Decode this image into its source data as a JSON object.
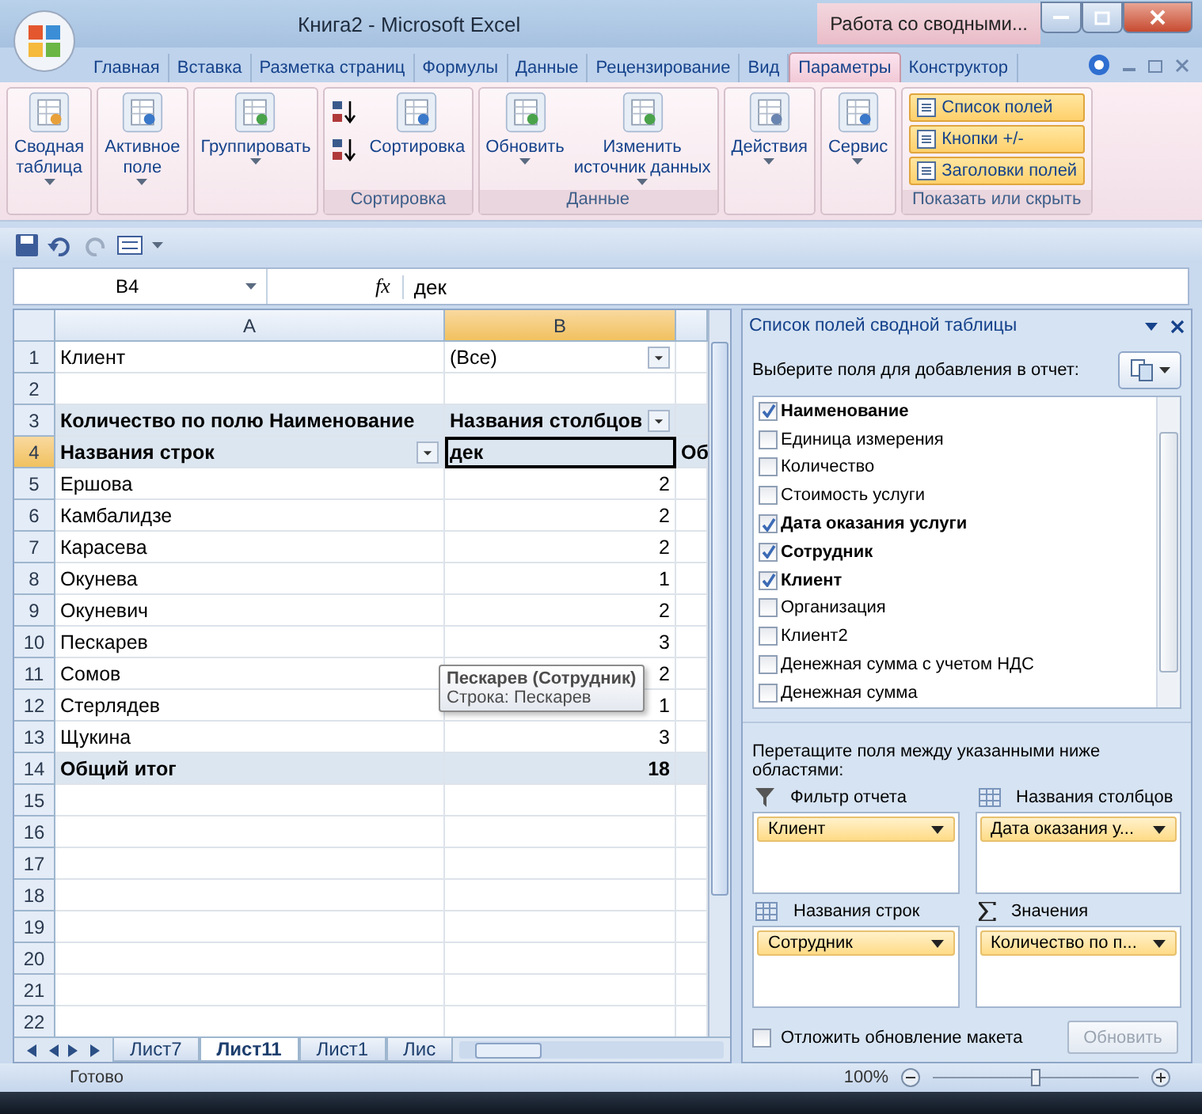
{
  "window": {
    "title": "Книга2 - Microsoft Excel",
    "context_title": "Работа со сводными..."
  },
  "ribbon_tabs": [
    {
      "label": "Главная",
      "selected": false
    },
    {
      "label": "Вставка",
      "selected": false
    },
    {
      "label": "Разметка страниц",
      "selected": false
    },
    {
      "label": "Формулы",
      "selected": false
    },
    {
      "label": "Данные",
      "selected": false
    },
    {
      "label": "Рецензирование",
      "selected": false
    },
    {
      "label": "Вид",
      "selected": false
    },
    {
      "label": "Параметры",
      "selected": true
    },
    {
      "label": "Конструктор",
      "selected": false
    }
  ],
  "ribbon_groups": [
    {
      "items": [
        {
          "kind": "large",
          "lines": [
            "Сводная",
            "таблица"
          ],
          "dropdown": true
        }
      ]
    },
    {
      "items": [
        {
          "kind": "large",
          "lines": [
            "Активное",
            "поле"
          ],
          "dropdown": true
        }
      ]
    },
    {
      "items": [
        {
          "kind": "large",
          "lines": [
            "Группировать"
          ],
          "dropdown": true
        }
      ]
    },
    {
      "label": "Сортировка",
      "items": [
        {
          "kind": "sort-stack"
        },
        {
          "kind": "large",
          "lines": [
            "Сортировка"
          ],
          "dropdown": false
        }
      ]
    },
    {
      "label": "Данные",
      "items": [
        {
          "kind": "large",
          "lines": [
            "Обновить"
          ],
          "dropdown": true
        },
        {
          "kind": "large",
          "lines": [
            "Изменить",
            "источник данных"
          ],
          "dropdown": true
        }
      ]
    },
    {
      "items": [
        {
          "kind": "large",
          "lines": [
            "Действия"
          ],
          "dropdown": true
        }
      ]
    },
    {
      "items": [
        {
          "kind": "large",
          "lines": [
            "Сервис"
          ],
          "dropdown": true
        }
      ]
    },
    {
      "label": "Показать или скрыть",
      "items": [
        {
          "kind": "toggle-stack",
          "toggles": [
            {
              "label": "Список полей",
              "on": true
            },
            {
              "label": "Кнопки +/-",
              "on": true
            },
            {
              "label": "Заголовки полей",
              "on": true
            }
          ]
        }
      ]
    }
  ],
  "formula_bar": {
    "cell": "B4",
    "fx": "fx",
    "value": "дек"
  },
  "columns": [
    {
      "label": "A",
      "selected": false
    },
    {
      "label": "B",
      "selected": true
    }
  ],
  "rows": [
    {
      "num": "1",
      "kind": "filter",
      "selected": false,
      "cells": [
        {
          "text": "Клиент"
        },
        {
          "text": "(Все)",
          "dropdown": true
        }
      ]
    },
    {
      "num": "2",
      "kind": "empty",
      "selected": false,
      "cells": []
    },
    {
      "num": "3",
      "kind": "header",
      "selected": false,
      "cells": [
        {
          "text": "Количество по полю Наименование"
        },
        {
          "text": "Названия столбцов",
          "dropdown": true
        }
      ]
    },
    {
      "num": "4",
      "kind": "header",
      "selected": true,
      "cells": [
        {
          "text": "Названия строк",
          "dropdown": true
        },
        {
          "text": "дек",
          "active": true
        },
        {
          "text": "Об"
        }
      ]
    },
    {
      "num": "5",
      "kind": "data",
      "selected": false,
      "cells": [
        {
          "text": "Ершова"
        },
        {
          "text": "2"
        }
      ]
    },
    {
      "num": "6",
      "kind": "data",
      "selected": false,
      "cells": [
        {
          "text": "Камбалидзе"
        },
        {
          "text": "2"
        }
      ]
    },
    {
      "num": "7",
      "kind": "data",
      "selected": false,
      "cells": [
        {
          "text": "Карасева"
        },
        {
          "text": "2"
        }
      ]
    },
    {
      "num": "8",
      "kind": "data",
      "selected": false,
      "cells": [
        {
          "text": "Окунева"
        },
        {
          "text": "1"
        }
      ]
    },
    {
      "num": "9",
      "kind": "data",
      "selected": false,
      "cells": [
        {
          "text": "Окуневич"
        },
        {
          "text": "2"
        }
      ]
    },
    {
      "num": "10",
      "kind": "data",
      "selected": false,
      "cells": [
        {
          "text": "Пескарев"
        },
        {
          "text": "3"
        }
      ]
    },
    {
      "num": "11",
      "kind": "data",
      "selected": false,
      "cells": [
        {
          "text": "Сомов"
        },
        {
          "text": "2"
        }
      ]
    },
    {
      "num": "12",
      "kind": "data",
      "selected": false,
      "cells": [
        {
          "text": "Стерлядев"
        },
        {
          "text": "1"
        }
      ]
    },
    {
      "num": "13",
      "kind": "data",
      "selected": false,
      "cells": [
        {
          "text": "Щукина"
        },
        {
          "text": "3"
        }
      ]
    },
    {
      "num": "14",
      "kind": "total",
      "selected": false,
      "cells": [
        {
          "text": "Общий итог"
        },
        {
          "text": "18"
        }
      ]
    },
    {
      "num": "15",
      "kind": "empty",
      "selected": false,
      "cells": []
    },
    {
      "num": "16",
      "kind": "empty",
      "selected": false,
      "cells": []
    },
    {
      "num": "17",
      "kind": "empty",
      "selected": false,
      "cells": []
    },
    {
      "num": "18",
      "kind": "empty",
      "selected": false,
      "cells": []
    },
    {
      "num": "19",
      "kind": "empty",
      "selected": false,
      "cells": []
    },
    {
      "num": "20",
      "kind": "empty",
      "selected": false,
      "cells": []
    },
    {
      "num": "21",
      "kind": "empty",
      "selected": false,
      "cells": []
    },
    {
      "num": "22",
      "kind": "empty",
      "selected": false,
      "cells": []
    }
  ],
  "tooltip": {
    "title": "Пескарев (Сотрудник)",
    "line": "Строка: Пескарев"
  },
  "sheet_tabs": [
    {
      "label": "Лист7",
      "selected": false
    },
    {
      "label": "Лист11",
      "selected": true
    },
    {
      "label": "Лист1",
      "selected": false
    },
    {
      "label": "Лис",
      "selected": false
    }
  ],
  "field_list": {
    "title": "Список полей сводной таблицы",
    "prompt": "Выберите поля для добавления в отчет:",
    "fields": [
      {
        "label": "Наименование",
        "checked": true
      },
      {
        "label": "Единица измерения",
        "checked": false
      },
      {
        "label": "Количество",
        "checked": false
      },
      {
        "label": "Стоимость услуги",
        "checked": false
      },
      {
        "label": "Дата оказания услуги",
        "checked": true
      },
      {
        "label": "Сотрудник",
        "checked": true
      },
      {
        "label": "Клиент",
        "checked": true
      },
      {
        "label": "Организация",
        "checked": false
      },
      {
        "label": "Клиент2",
        "checked": false
      },
      {
        "label": "Денежная сумма с учетом НДС",
        "checked": false
      },
      {
        "label": "Денежная сумма",
        "checked": false
      }
    ],
    "drag_hint": "Перетащите поля между указанными ниже областями:",
    "areas": [
      {
        "kind": "filter",
        "label": "Фильтр отчета",
        "chips": [
          "Клиент"
        ]
      },
      {
        "kind": "columns",
        "label": "Названия столбцов",
        "chips": [
          "Дата оказания у..."
        ]
      },
      {
        "kind": "rows",
        "label": "Названия строк",
        "chips": [
          "Сотрудник"
        ]
      },
      {
        "kind": "values",
        "label": "Значения",
        "chips": [
          "Количество по п..."
        ]
      }
    ],
    "defer": {
      "label": "Отложить обновление макета",
      "checked": false
    },
    "update_button": {
      "label": "Обновить",
      "disabled": true
    }
  },
  "status_bar": {
    "text": "Готово",
    "zoom": "100%",
    "zoom_slider": {
      "level": 0.5
    }
  }
}
